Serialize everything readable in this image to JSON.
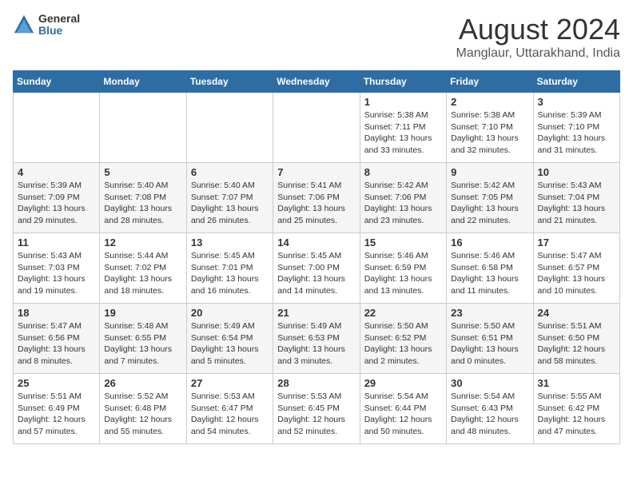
{
  "header": {
    "logo_general": "General",
    "logo_blue": "Blue",
    "month": "August 2024",
    "location": "Manglaur, Uttarakhand, India"
  },
  "days_of_week": [
    "Sunday",
    "Monday",
    "Tuesday",
    "Wednesday",
    "Thursday",
    "Friday",
    "Saturday"
  ],
  "weeks": [
    [
      {
        "day": "",
        "info": ""
      },
      {
        "day": "",
        "info": ""
      },
      {
        "day": "",
        "info": ""
      },
      {
        "day": "",
        "info": ""
      },
      {
        "day": "1",
        "info": "Sunrise: 5:38 AM\nSunset: 7:11 PM\nDaylight: 13 hours\nand 33 minutes."
      },
      {
        "day": "2",
        "info": "Sunrise: 5:38 AM\nSunset: 7:10 PM\nDaylight: 13 hours\nand 32 minutes."
      },
      {
        "day": "3",
        "info": "Sunrise: 5:39 AM\nSunset: 7:10 PM\nDaylight: 13 hours\nand 31 minutes."
      }
    ],
    [
      {
        "day": "4",
        "info": "Sunrise: 5:39 AM\nSunset: 7:09 PM\nDaylight: 13 hours\nand 29 minutes."
      },
      {
        "day": "5",
        "info": "Sunrise: 5:40 AM\nSunset: 7:08 PM\nDaylight: 13 hours\nand 28 minutes."
      },
      {
        "day": "6",
        "info": "Sunrise: 5:40 AM\nSunset: 7:07 PM\nDaylight: 13 hours\nand 26 minutes."
      },
      {
        "day": "7",
        "info": "Sunrise: 5:41 AM\nSunset: 7:06 PM\nDaylight: 13 hours\nand 25 minutes."
      },
      {
        "day": "8",
        "info": "Sunrise: 5:42 AM\nSunset: 7:06 PM\nDaylight: 13 hours\nand 23 minutes."
      },
      {
        "day": "9",
        "info": "Sunrise: 5:42 AM\nSunset: 7:05 PM\nDaylight: 13 hours\nand 22 minutes."
      },
      {
        "day": "10",
        "info": "Sunrise: 5:43 AM\nSunset: 7:04 PM\nDaylight: 13 hours\nand 21 minutes."
      }
    ],
    [
      {
        "day": "11",
        "info": "Sunrise: 5:43 AM\nSunset: 7:03 PM\nDaylight: 13 hours\nand 19 minutes."
      },
      {
        "day": "12",
        "info": "Sunrise: 5:44 AM\nSunset: 7:02 PM\nDaylight: 13 hours\nand 18 minutes."
      },
      {
        "day": "13",
        "info": "Sunrise: 5:45 AM\nSunset: 7:01 PM\nDaylight: 13 hours\nand 16 minutes."
      },
      {
        "day": "14",
        "info": "Sunrise: 5:45 AM\nSunset: 7:00 PM\nDaylight: 13 hours\nand 14 minutes."
      },
      {
        "day": "15",
        "info": "Sunrise: 5:46 AM\nSunset: 6:59 PM\nDaylight: 13 hours\nand 13 minutes."
      },
      {
        "day": "16",
        "info": "Sunrise: 5:46 AM\nSunset: 6:58 PM\nDaylight: 13 hours\nand 11 minutes."
      },
      {
        "day": "17",
        "info": "Sunrise: 5:47 AM\nSunset: 6:57 PM\nDaylight: 13 hours\nand 10 minutes."
      }
    ],
    [
      {
        "day": "18",
        "info": "Sunrise: 5:47 AM\nSunset: 6:56 PM\nDaylight: 13 hours\nand 8 minutes."
      },
      {
        "day": "19",
        "info": "Sunrise: 5:48 AM\nSunset: 6:55 PM\nDaylight: 13 hours\nand 7 minutes."
      },
      {
        "day": "20",
        "info": "Sunrise: 5:49 AM\nSunset: 6:54 PM\nDaylight: 13 hours\nand 5 minutes."
      },
      {
        "day": "21",
        "info": "Sunrise: 5:49 AM\nSunset: 6:53 PM\nDaylight: 13 hours\nand 3 minutes."
      },
      {
        "day": "22",
        "info": "Sunrise: 5:50 AM\nSunset: 6:52 PM\nDaylight: 13 hours\nand 2 minutes."
      },
      {
        "day": "23",
        "info": "Sunrise: 5:50 AM\nSunset: 6:51 PM\nDaylight: 13 hours\nand 0 minutes."
      },
      {
        "day": "24",
        "info": "Sunrise: 5:51 AM\nSunset: 6:50 PM\nDaylight: 12 hours\nand 58 minutes."
      }
    ],
    [
      {
        "day": "25",
        "info": "Sunrise: 5:51 AM\nSunset: 6:49 PM\nDaylight: 12 hours\nand 57 minutes."
      },
      {
        "day": "26",
        "info": "Sunrise: 5:52 AM\nSunset: 6:48 PM\nDaylight: 12 hours\nand 55 minutes."
      },
      {
        "day": "27",
        "info": "Sunrise: 5:53 AM\nSunset: 6:47 PM\nDaylight: 12 hours\nand 54 minutes."
      },
      {
        "day": "28",
        "info": "Sunrise: 5:53 AM\nSunset: 6:45 PM\nDaylight: 12 hours\nand 52 minutes."
      },
      {
        "day": "29",
        "info": "Sunrise: 5:54 AM\nSunset: 6:44 PM\nDaylight: 12 hours\nand 50 minutes."
      },
      {
        "day": "30",
        "info": "Sunrise: 5:54 AM\nSunset: 6:43 PM\nDaylight: 12 hours\nand 48 minutes."
      },
      {
        "day": "31",
        "info": "Sunrise: 5:55 AM\nSunset: 6:42 PM\nDaylight: 12 hours\nand 47 minutes."
      }
    ]
  ]
}
